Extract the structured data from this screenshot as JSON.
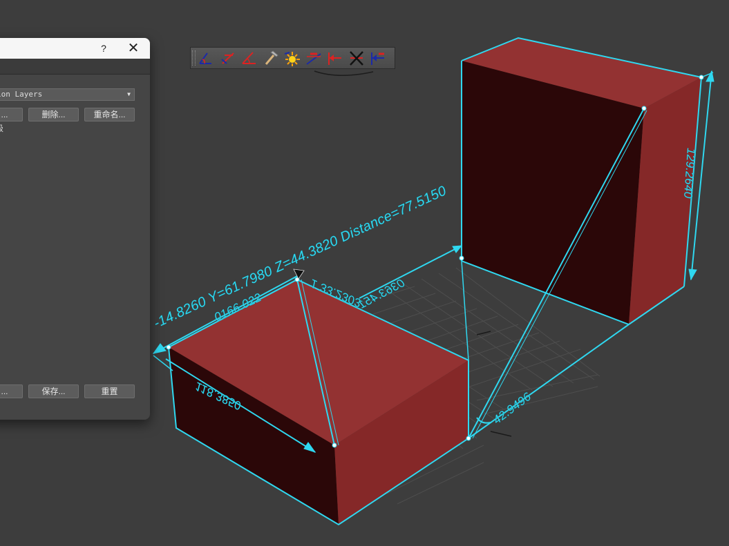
{
  "colors": {
    "viewport_bg": "#3d3d3d",
    "box_dark": "#2b0708",
    "box_side": "#852828",
    "box_top": "#933232",
    "highlight": "#2fd8f0",
    "grid": "#4f4f4f"
  },
  "dialog": {
    "help_label": "?",
    "close_label": "✕",
    "layer_select": {
      "value": "ion Layers"
    },
    "buttons_top": [
      {
        "label": "..."
      },
      {
        "label": "删除..."
      },
      {
        "label": "重命名..."
      }
    ],
    "partial_item": "级",
    "buttons_bottom": [
      {
        "label": "..."
      },
      {
        "label": "保存..."
      },
      {
        "label": "重置"
      }
    ]
  },
  "toolbar": {
    "tools": [
      {
        "icon": "angle-measure-icon"
      },
      {
        "icon": "perpendicular-measure-icon"
      },
      {
        "icon": "slope-measure-icon"
      },
      {
        "icon": "hammer-icon"
      },
      {
        "icon": "light-burst-icon"
      },
      {
        "icon": "dimension-text-icon"
      },
      {
        "icon": "arrow-dimension-icon"
      },
      {
        "icon": "delete-dimension-icon"
      },
      {
        "icon": "offset-dimension-icon"
      }
    ]
  },
  "viewport": {
    "labels": {
      "coords": "-14.8260 Y=61.7980 Z=44.3820 Distance=77.5150",
      "edge_top_left": "0166.022",
      "diagonal_box1": "1 33.2303",
      "edge_front": "118.3850",
      "edge_back_floor": "0363.451",
      "vertical_right": "129.2640",
      "angle": "42.9496"
    }
  }
}
